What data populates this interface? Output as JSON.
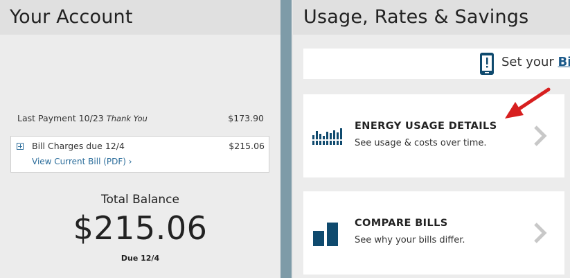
{
  "account": {
    "title": "Your Account",
    "last_payment_label": "Last Payment 10/23",
    "thank_you": "Thank You",
    "last_payment_amount": "$173.90",
    "bill_charges_label": "Bill Charges due 12/4",
    "bill_charges_amount": "$215.06",
    "view_bill_link": "View Current Bill (PDF) ›",
    "total_label": "Total Balance",
    "total_amount": "$215.06",
    "due_label": "Due 12/4"
  },
  "usage": {
    "title": "Usage, Rates & Savings",
    "alert_prefix": "Set your ",
    "alert_link": "Bil",
    "cards": [
      {
        "title": "ENERGY USAGE DETAILS",
        "subtitle": "See usage & costs over time.",
        "icon": "bar-chart-icon"
      },
      {
        "title": "COMPARE BILLS",
        "subtitle": "See why your bills differ.",
        "icon": "compare-bars-icon"
      }
    ]
  },
  "colors": {
    "accent_blue": "#1c5a8a",
    "icon_navy": "#0f4a6e",
    "annotation_red": "#d71f1f"
  }
}
